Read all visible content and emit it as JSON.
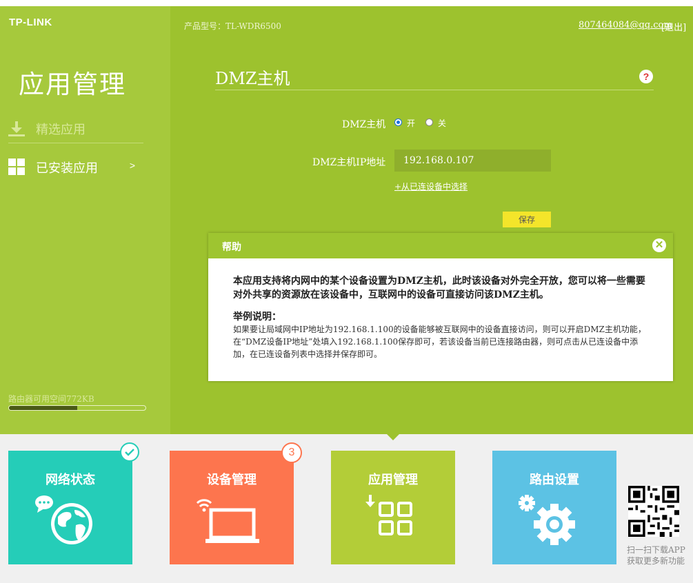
{
  "header": {
    "logo": "TP-LINK",
    "model_label": "产品型号：TL-WDR6500",
    "account": "807464084@qq.com",
    "logout": "[退出]"
  },
  "sidebar": {
    "title": "应用管理",
    "items": [
      {
        "label": "精选应用",
        "icon": "download-icon"
      },
      {
        "label": "已安装应用",
        "icon": "grid-icon",
        "chevron": ">"
      }
    ],
    "storage_label": "路由器可用空间772KB",
    "storage_fraction": 0.5
  },
  "main": {
    "title": "DMZ主机",
    "help_icon": "?",
    "dmz_label": "DMZ主机",
    "radio_on": "开",
    "radio_off": "关",
    "radio_selected": "on",
    "ip_label": "DMZ主机IP地址",
    "ip_value": "192.168.0.107",
    "select_link": "+从已连设备中选择",
    "save": "保存"
  },
  "help": {
    "title": "帮助",
    "main_text": "本应用支持将内网中的某个设备设置为DMZ主机，此时该设备对外完全开放，您可以将一些需要对外共享的资源放在该设备中，互联网中的设备可直接访问该DMZ主机。",
    "example_heading": "举例说明：",
    "example_text": "如果要让局域网中IP地址为192.168.1.100的设备能够被互联网中的设备直接访问，则可以开启DMZ主机功能，在“DMZ设备IP地址”处填入192.168.1.100保存即可，若该设备当前已连接路由器，则可点击从已连设备中添加，在已连设备列表中选择并保存即可。"
  },
  "tiles": [
    {
      "label": "网络状态",
      "color": "#25cdb8",
      "icon": "globe-chat-icon",
      "badge": "check"
    },
    {
      "label": "设备管理",
      "color": "#fd754e",
      "icon": "laptop-wifi-icon",
      "badge": "3"
    },
    {
      "label": "应用管理",
      "color": "#b3cd38",
      "icon": "apps-grid-icon",
      "active": true
    },
    {
      "label": "路由设置",
      "color": "#5cc2e4",
      "icon": "gears-icon"
    }
  ],
  "qr": {
    "text": "扫一扫下载APP获取更多新功能"
  },
  "colors": {
    "sidebar_green": "#a6c93c",
    "content_green": "#9dc22e",
    "save_yellow": "#f4e52a"
  }
}
